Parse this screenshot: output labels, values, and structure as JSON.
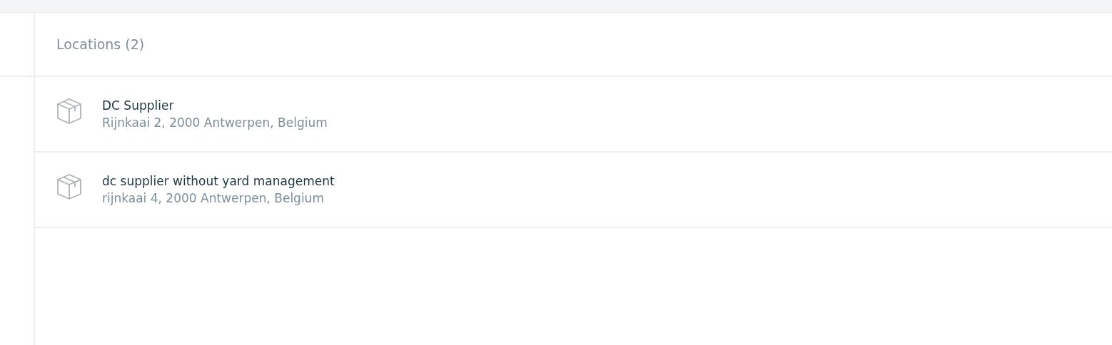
{
  "panel": {
    "title": "Locations (2)"
  },
  "locations": [
    {
      "name": "DC Supplier",
      "address": "Rijnkaai 2, 2000 Antwerpen, Belgium"
    },
    {
      "name": "dc supplier without yard management",
      "address": "rijnkaai 4, 2000 Antwerpen, Belgium"
    }
  ]
}
